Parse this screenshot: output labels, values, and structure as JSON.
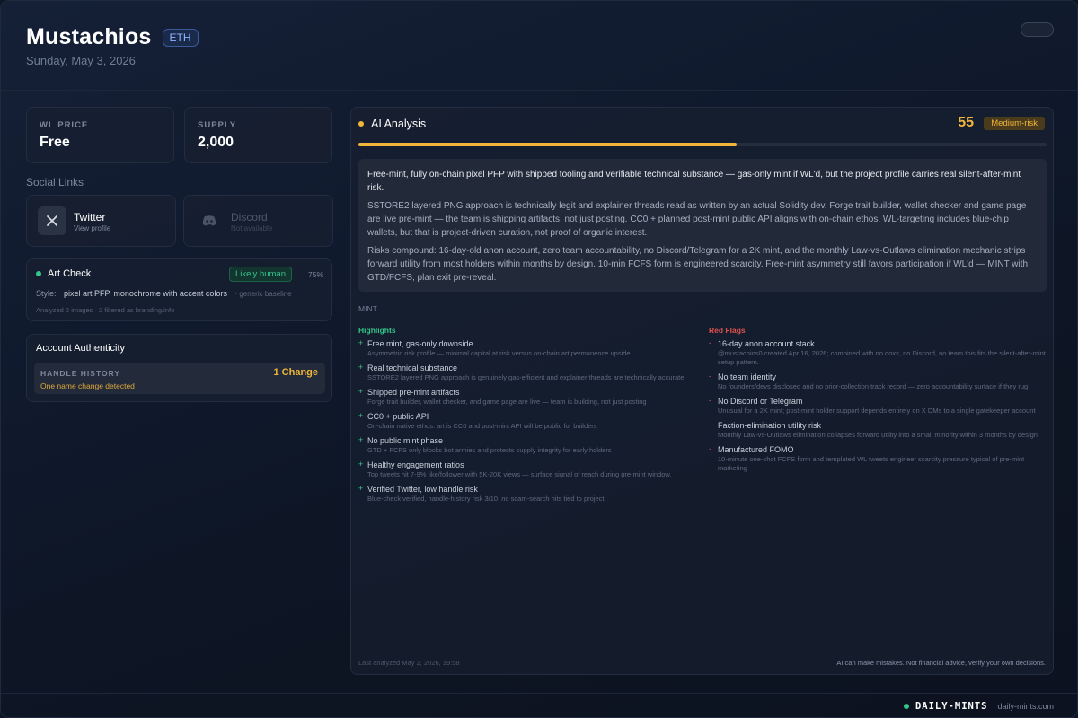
{
  "header": {
    "title": "Mustachios",
    "chain": "ETH",
    "date": "Sunday, May 3, 2026"
  },
  "stats": {
    "wl_price_label": "WL PRICE",
    "wl_price_value": "Free",
    "supply_label": "SUPPLY",
    "supply_value": "2,000"
  },
  "social": {
    "section_title": "Social Links",
    "twitter": {
      "name": "Twitter",
      "sub": "View profile",
      "icon": "x-icon"
    },
    "discord": {
      "name": "Discord",
      "sub": "Not available",
      "icon": "discord-icon"
    }
  },
  "art_check": {
    "title": "Art Check",
    "verdict": "Likely human",
    "confidence": "75%",
    "style_label": "Style:",
    "style_value": "pixel art PFP, monochrome with accent colors",
    "style_extra": "· generic baseline",
    "analyzed": "Analyzed 2 images · 2 filtered as branding/info"
  },
  "authenticity": {
    "title": "Account Authenticity",
    "handle_label": "HANDLE HISTORY",
    "handle_sub": "One name change detected",
    "handle_value": "1 Change"
  },
  "ai": {
    "title": "AI Analysis",
    "score": "55",
    "score_fraction": 0.55,
    "risk": "Medium-risk",
    "summary": [
      "Free-mint, fully on-chain pixel PFP with shipped tooling and verifiable technical substance — gas-only mint if WL'd, but the project profile carries real silent-after-mint risk.",
      "SSTORE2 layered PNG approach is technically legit and explainer threads read as written by an actual Solidity dev. Forge trait builder, wallet checker and game page are live pre-mint — the team is shipping artifacts, not just posting. CC0 + planned post-mint public API aligns with on-chain ethos. WL-targeting includes blue-chip wallets, but that is project-driven curation, not proof of organic interest.",
      "Risks compound: 16-day-old anon account, zero team accountability, no Discord/Telegram for a 2K mint, and the monthly Law-vs-Outlaws elimination mechanic strips forward utility from most holders within months by design. 10-min FCFS form is engineered scarcity. Free-mint asymmetry still favors participation if WL'd — MINT with GTD/FCFS, plan exit pre-reveal."
    ],
    "verdict": "MINT",
    "highlights_title": "Highlights",
    "highlights": [
      {
        "title": "Free mint, gas-only downside",
        "desc": "Asymmetric risk profile — minimal capital at risk versus on-chain art permanence upside"
      },
      {
        "title": "Real technical substance",
        "desc": "SSTORE2 layered PNG approach is genuinely gas-efficient and explainer threads are technically accurate"
      },
      {
        "title": "Shipped pre-mint artifacts",
        "desc": "Forge trait builder, wallet checker, and game page are live — team is building, not just posting"
      },
      {
        "title": "CC0 + public API",
        "desc": "On-chain native ethos: art is CC0 and post-mint API will be public for builders"
      },
      {
        "title": "No public mint phase",
        "desc": "GTD + FCFS only blocks bot armies and protects supply integrity for early holders"
      },
      {
        "title": "Healthy engagement ratios",
        "desc": "Top tweets hit 7-9% like/follower with 5K-20K views — surface signal of reach during pre-mint window."
      },
      {
        "title": "Verified Twitter, low handle risk",
        "desc": "Blue-check verified, handle-history risk 3/10, no scam-search hits tied to project"
      }
    ],
    "red_flags_title": "Red Flags",
    "red_flags": [
      {
        "title": "16-day anon account stack",
        "desc": "@mustachios0 created Apr 16, 2026; combined with no doxx, no Discord, no team this fits the silent-after-mint setup pattern."
      },
      {
        "title": "No team identity",
        "desc": "No founders/devs disclosed and no prior-collection track record — zero accountability surface if they rug"
      },
      {
        "title": "No Discord or Telegram",
        "desc": "Unusual for a 2K mint; post-mint holder support depends entirely on X DMs to a single gatekeeper account"
      },
      {
        "title": "Faction-elimination utility risk",
        "desc": "Monthly Law-vs-Outlaws elimination collapses forward utility into a small minority within 3 months by design"
      },
      {
        "title": "Manufactured FOMO",
        "desc": "10-minute one-shot FCFS form and templated WL tweets engineer scarcity pressure typical of pre-mint marketing"
      }
    ],
    "last_analyzed": "Last analyzed May 2, 2026, 19:58",
    "disclaimer": "AI can make mistakes. Not financial advice, verify your own decisions."
  },
  "footer": {
    "brand": "DAILY-MINTS",
    "url": "daily-mints.com"
  },
  "colors": {
    "accent_yellow": "#f0b53a",
    "green": "#35c48a",
    "red": "#e0524f"
  }
}
